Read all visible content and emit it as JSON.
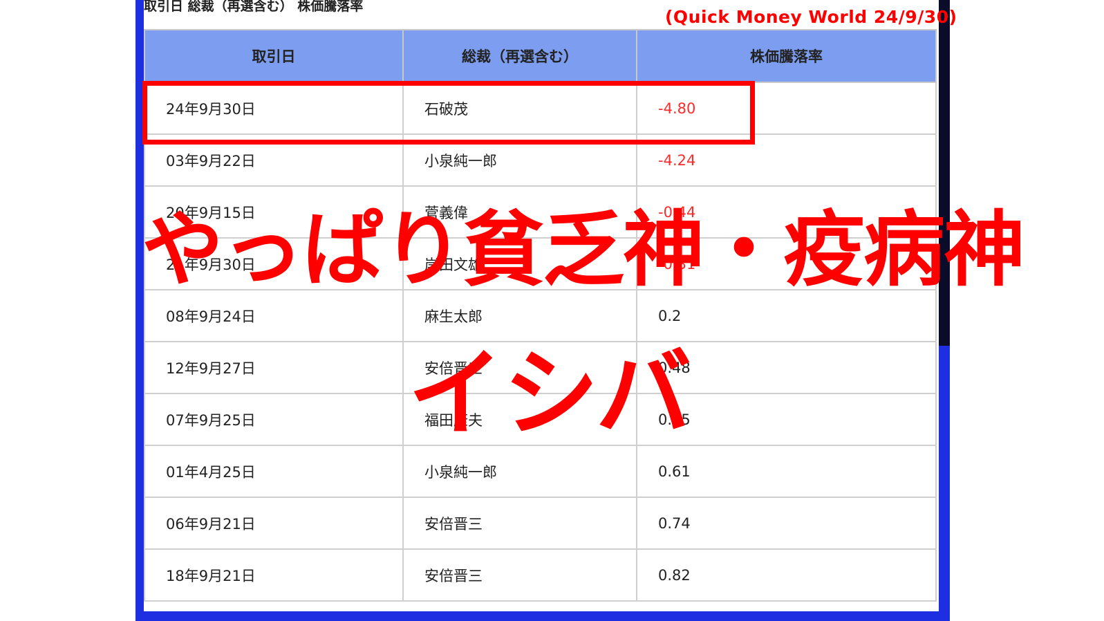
{
  "caption": "取引日 総裁（再選含む） 株価騰落率",
  "source": "(Quick Money World 24/9/30)",
  "table": {
    "headers": [
      "取引日",
      "総裁（再選含む）",
      "株価騰落率"
    ],
    "rows": [
      {
        "date": "24年9月30日",
        "pm": "石破茂",
        "rate": "-4.80"
      },
      {
        "date": "03年9月22日",
        "pm": "小泉純一郎",
        "rate": "-4.24"
      },
      {
        "date": "20年9月15日",
        "pm": "菅義偉",
        "rate": "-0.44"
      },
      {
        "date": "21年9月30日",
        "pm": "岸田文雄",
        "rate": "-0.31"
      },
      {
        "date": "08年9月24日",
        "pm": "麻生太郎",
        "rate": "0.2"
      },
      {
        "date": "12年9月27日",
        "pm": "安倍晋三",
        "rate": "0.48"
      },
      {
        "date": "07年9月25日",
        "pm": "福田康夫",
        "rate": "0.55"
      },
      {
        "date": "01年4月25日",
        "pm": "小泉純一郎",
        "rate": "0.61"
      },
      {
        "date": "06年9月21日",
        "pm": "安倍晋三",
        "rate": "0.74"
      },
      {
        "date": "18年9月21日",
        "pm": "安倍晋三",
        "rate": "0.82"
      }
    ]
  },
  "overlay": {
    "line1": "やっぱり貧乏神・疫病神",
    "line2": "イシバ"
  },
  "colors": {
    "frame": "#1d2fe0",
    "header_bg": "#7d9ef0",
    "accent": "#ff0000"
  }
}
